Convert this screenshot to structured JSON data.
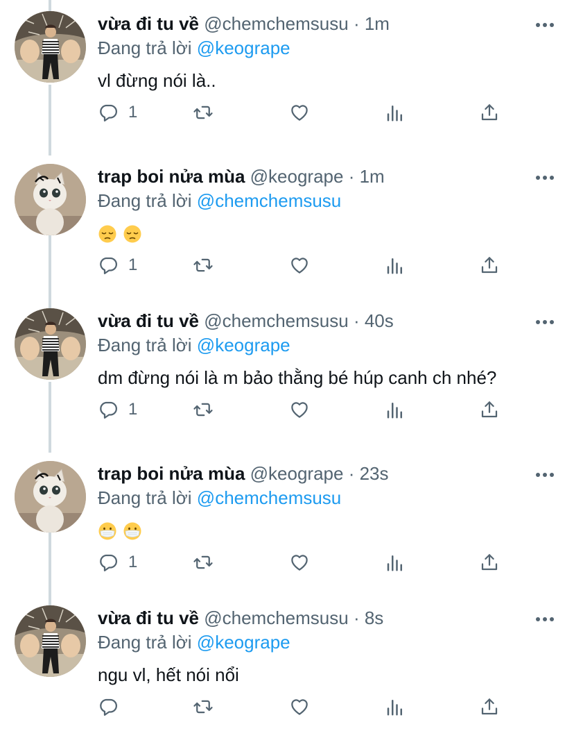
{
  "tweets": [
    {
      "name": "vừa đi tu về",
      "handle": "@chemchemsusu",
      "separator": "·",
      "time": "1m",
      "reply_prefix": "Đang trả lời",
      "reply_mention": "@keogrape",
      "text": "vl đừng nói là..",
      "avatar": "person-photo",
      "reply_count": "1"
    },
    {
      "name": "trap boi nửa mùa",
      "handle": "@keogrape",
      "separator": "·",
      "time": "1m",
      "reply_prefix": "Đang trả lời",
      "reply_mention": "@chemchemsusu",
      "emojis": [
        "pensive-face",
        "pensive-face"
      ],
      "avatar": "cat-photo",
      "reply_count": "1"
    },
    {
      "name": "vừa đi tu về",
      "handle": "@chemchemsusu",
      "separator": "·",
      "time": "40s",
      "reply_prefix": "Đang trả lời",
      "reply_mention": "@keogrape",
      "text": "dm đừng nói là m bảo thằng bé húp canh ch nhé?",
      "avatar": "person-photo",
      "reply_count": "1"
    },
    {
      "name": "trap boi nửa mùa",
      "handle": "@keogrape",
      "separator": "·",
      "time": "23s",
      "reply_prefix": "Đang trả lời",
      "reply_mention": "@chemchemsusu",
      "emojis": [
        "face-with-medical-mask",
        "face-with-medical-mask"
      ],
      "avatar": "cat-photo",
      "reply_count": "1"
    },
    {
      "name": "vừa đi tu về",
      "handle": "@chemchemsusu",
      "separator": "·",
      "time": "8s",
      "reply_prefix": "Đang trả lời",
      "reply_mention": "@keogrape",
      "text": "ngu vl, hết nói nổi",
      "avatar": "person-photo",
      "reply_count": ""
    }
  ],
  "icons": {
    "reply": "reply-icon",
    "retweet": "retweet-icon",
    "like": "like-icon",
    "views": "views-icon",
    "share": "share-icon",
    "more": "more-icon"
  },
  "colors": {
    "mention": "#1d9bf0",
    "secondary_text": "#536471",
    "primary_text": "#0f1419",
    "thread_line": "#cfd9de"
  }
}
